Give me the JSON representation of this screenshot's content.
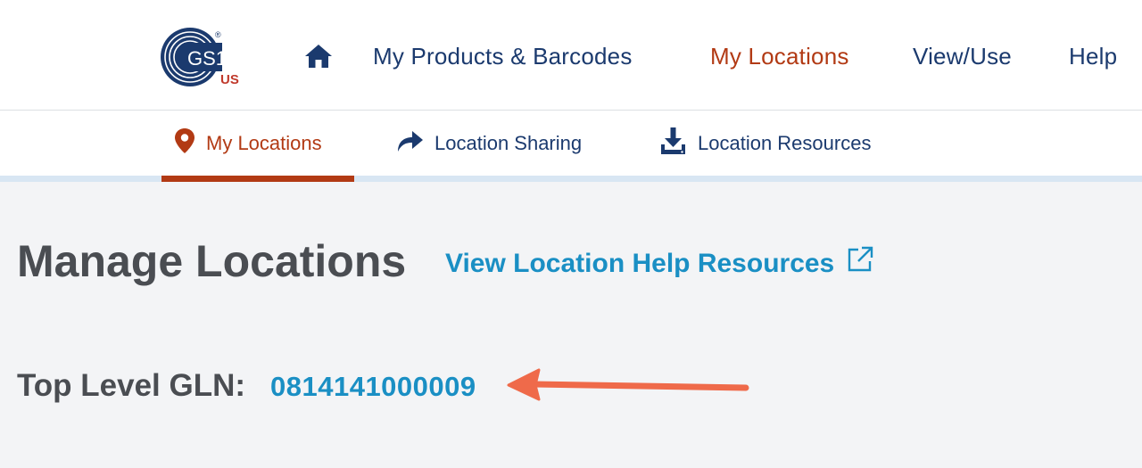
{
  "logo": {
    "text": "GS1",
    "sub": "US",
    "mark": "®"
  },
  "nav": {
    "home_icon": "home-icon",
    "items": [
      {
        "label": "My Products & Barcodes"
      },
      {
        "label": "My Locations"
      },
      {
        "label": "View/Use"
      },
      {
        "label": "Help"
      }
    ],
    "active_index": 1
  },
  "subnav": {
    "items": [
      {
        "label": "My Locations",
        "icon": "map-pin-icon"
      },
      {
        "label": "Location Sharing",
        "icon": "share-arrow-icon"
      },
      {
        "label": "Location Resources",
        "icon": "download-icon"
      }
    ],
    "active_index": 0
  },
  "page": {
    "title": "Manage Locations",
    "help_link": "View Location Help Resources",
    "help_link_icon": "external-link-icon"
  },
  "gln": {
    "label": "Top Level GLN:",
    "value": "0814141000009"
  },
  "annotation": {
    "icon": "pointer-arrow-icon",
    "color": "#ef6a4a"
  },
  "colors": {
    "navy": "#1b3a6e",
    "accent_red": "#b23a14",
    "link_blue": "#1a8fc4",
    "heading_gray": "#4a4d52",
    "page_bg": "#f3f4f6"
  }
}
